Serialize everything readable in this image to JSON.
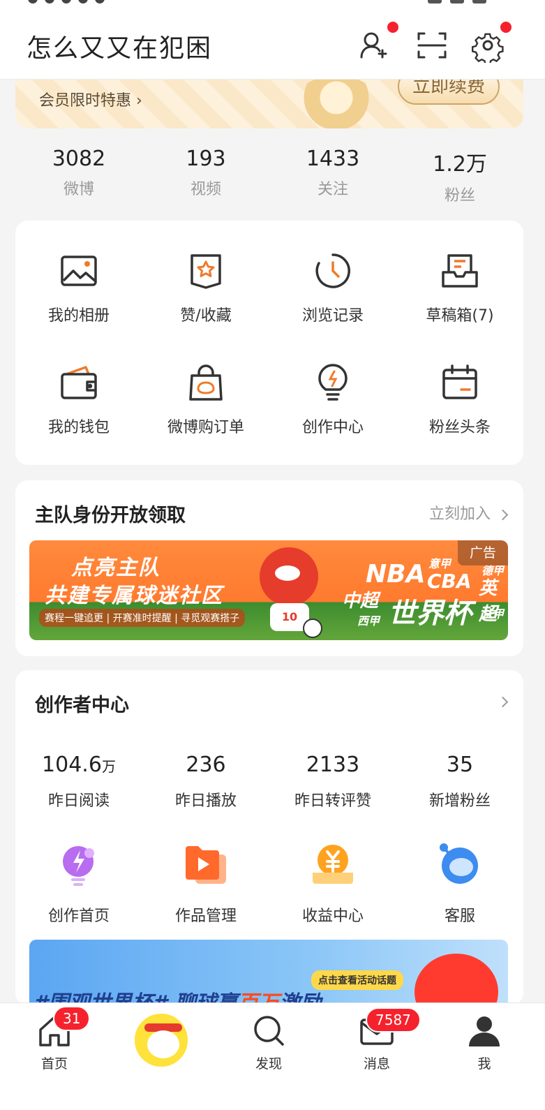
{
  "header": {
    "username": "怎么又又在犯困"
  },
  "vip": {
    "promo_label": "会员限时特惠 ›",
    "renew_label": "立即续费"
  },
  "stats": [
    {
      "num": "3082",
      "label": "微博"
    },
    {
      "num": "193",
      "label": "视频"
    },
    {
      "num": "1433",
      "label": "关注"
    },
    {
      "num": "1.2万",
      "label": "粉丝"
    }
  ],
  "shortcuts": [
    {
      "label": "我的相册",
      "icon": "album-icon"
    },
    {
      "label": "赞/收藏",
      "icon": "favorites-icon"
    },
    {
      "label": "浏览记录",
      "icon": "history-icon"
    },
    {
      "label": "草稿箱(7)",
      "icon": "drafts-icon"
    },
    {
      "label": "我的钱包",
      "icon": "wallet-icon"
    },
    {
      "label": "微博购订单",
      "icon": "shopping-bag-icon"
    },
    {
      "label": "创作中心",
      "icon": "lightbulb-icon"
    },
    {
      "label": "粉丝头条",
      "icon": "calendar-icon"
    }
  ],
  "team_card": {
    "title": "主队身份开放领取",
    "link": "立刻加入",
    "ad_tag": "广告",
    "headline1": "点亮主队",
    "headline2": "共建专属球迷社区",
    "sub": "赛程一键追更 | 开赛准时提醒 | 寻觅观赛搭子",
    "leagues": [
      "NBA",
      "意甲",
      "德甲",
      "CBA",
      "英超",
      "中超",
      "西甲",
      "世界杯",
      "法甲"
    ],
    "jersey_number": "10"
  },
  "creator": {
    "title": "创作者中心",
    "stats": [
      {
        "num": "104.6",
        "unit": "万",
        "label": "昨日阅读"
      },
      {
        "num": "236",
        "unit": "",
        "label": "昨日播放"
      },
      {
        "num": "2133",
        "unit": "",
        "label": "昨日转评赞"
      },
      {
        "num": "35",
        "unit": "",
        "label": "新增粉丝"
      }
    ],
    "tools": [
      {
        "label": "创作首页",
        "icon": "creation-home-icon"
      },
      {
        "label": "作品管理",
        "icon": "works-manage-icon"
      },
      {
        "label": "收益中心",
        "icon": "income-icon"
      },
      {
        "label": "客服",
        "icon": "customer-service-icon"
      }
    ],
    "banner_pill": "点击查看活动话题",
    "banner_text_a": "#围观世界杯# 聊球赢",
    "banner_text_b": "百万",
    "banner_text_c": "激励"
  },
  "tabbar": {
    "tabs": [
      {
        "label": "首页",
        "badge": "31"
      },
      {
        "label": "",
        "badge": ""
      },
      {
        "label": "发现",
        "badge": ""
      },
      {
        "label": "消息",
        "badge": "7587"
      },
      {
        "label": "我",
        "badge": ""
      }
    ]
  },
  "colors": {
    "accent": "#f07a2c",
    "badge_red": "#f5222d",
    "icon_dark": "#333333"
  }
}
